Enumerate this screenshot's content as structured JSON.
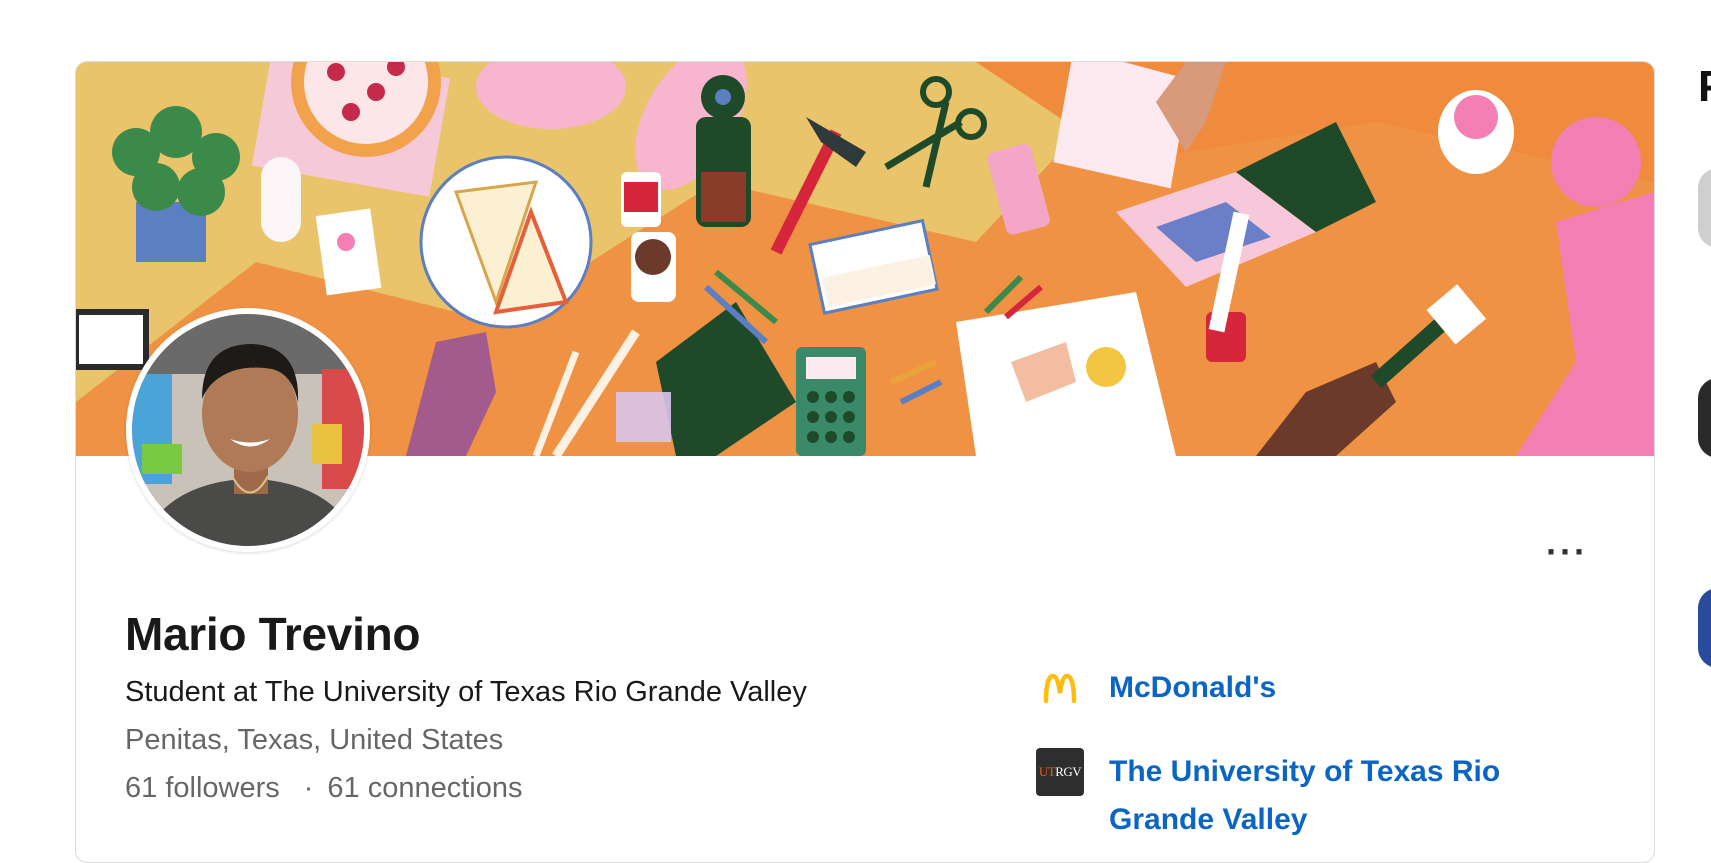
{
  "profile": {
    "name": "Mario Trevino",
    "headline": "Student at The University of Texas Rio Grande Valley",
    "location": "Penitas, Texas, United States",
    "followers": "61 followers",
    "separator": "·",
    "connections": "61 connections",
    "more_label": "···"
  },
  "organizations": [
    {
      "name": "McDonald's",
      "logo_icon": "mcdonalds-logo-icon"
    },
    {
      "name": "The University of Texas Rio Grande Valley",
      "logo_text": "UTRGV",
      "logo_icon": "utrgv-logo-icon"
    }
  ],
  "sidebar_peek": {
    "letter": "P"
  },
  "colors": {
    "link_blue": "#0a66c2",
    "cover_background": "#e9c46a",
    "mcdonalds_yellow": "#ffbc0d"
  }
}
